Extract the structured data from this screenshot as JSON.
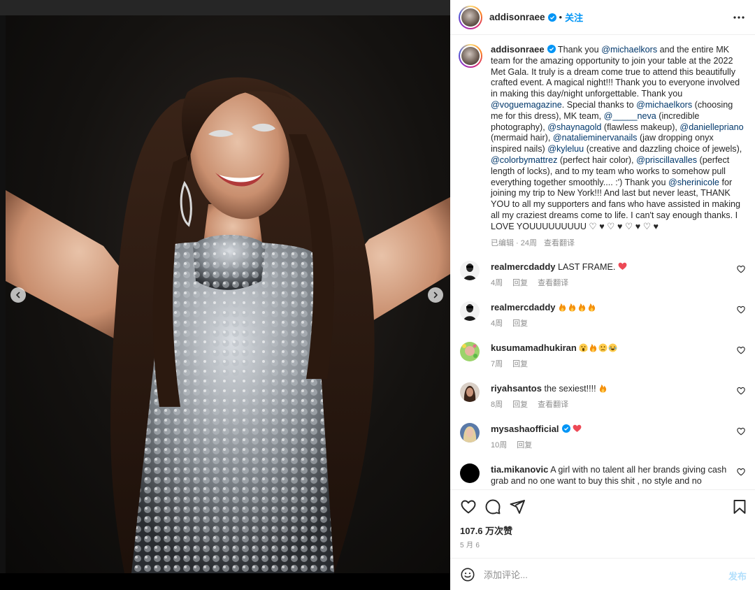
{
  "post": {
    "username": "addisonraee",
    "follow_label": "关注",
    "separator": "•"
  },
  "caption": {
    "username": "addisonraee",
    "segments": [
      {
        "t": "Thank you ",
        "m": false
      },
      {
        "t": "@michaelkors",
        "m": true
      },
      {
        "t": " and the entire MK team for the amazing opportunity to join your table at the 2022 Met Gala. It truly is a dream come true to attend this beautifully crafted event. A magical night!!! Thank you to everyone involved in making this day/night unforgettable. Thank you ",
        "m": false
      },
      {
        "t": "@voguemagazine",
        "m": true
      },
      {
        "t": ". Special thanks to ",
        "m": false
      },
      {
        "t": "@michaelkors",
        "m": true
      },
      {
        "t": " (choosing me for this dress), MK team, ",
        "m": false
      },
      {
        "t": "@_____neva",
        "m": true
      },
      {
        "t": " (incredible photography), ",
        "m": false
      },
      {
        "t": "@shaynagold",
        "m": true
      },
      {
        "t": " (flawless makeup), ",
        "m": false
      },
      {
        "t": "@daniellepriano",
        "m": true
      },
      {
        "t": " (mermaid hair), ",
        "m": false
      },
      {
        "t": "@natalieminervanails",
        "m": true
      },
      {
        "t": " (jaw dropping onyx inspired nails) ",
        "m": false
      },
      {
        "t": "@kyleluu",
        "m": true
      },
      {
        "t": " (creative and dazzling choice of jewels), ",
        "m": false
      },
      {
        "t": "@colorbymattrez",
        "m": true
      },
      {
        "t": " (perfect hair color), ",
        "m": false
      },
      {
        "t": "@priscillavalles",
        "m": true
      },
      {
        "t": " (perfect length of locks), and to my team who works to somehow pull everything together smoothly.... :') Thank you ",
        "m": false
      },
      {
        "t": "@sherinicole",
        "m": true
      },
      {
        "t": " for joining my trip to New York!!! And last but never least, THANK YOU to all my supporters and fans who have assisted in making all my craziest dreams come to life. I can't say enough thanks. I LOVE YOUUUUUUUUU ♡ ♥ ♡ ♥ ♡ ♥ ♡ ♥",
        "m": false
      }
    ],
    "edited": "已编辑 · 24周",
    "translate": "查看翻译"
  },
  "comments": [
    {
      "user": "realmercdaddy",
      "text": "LAST FRAME.",
      "emoji": [
        "heart"
      ],
      "verified": false,
      "age": "4周",
      "reply": "回复",
      "translate": "查看翻译",
      "avatar": "bw-man"
    },
    {
      "user": "realmercdaddy",
      "text": "",
      "emoji": [
        "fire",
        "fire",
        "fire",
        "fire"
      ],
      "verified": false,
      "age": "4周",
      "reply": "回复",
      "translate": "",
      "avatar": "bw-man"
    },
    {
      "user": "kusumamadhukiran",
      "text": "",
      "emoji": [
        "scream",
        "fire",
        "sad",
        "laugh"
      ],
      "verified": false,
      "age": "7周",
      "reply": "回复",
      "translate": "",
      "avatar": "green"
    },
    {
      "user": "riyahsantos",
      "text": "the sexiest!!!!",
      "emoji": [
        "fire"
      ],
      "verified": false,
      "age": "8周",
      "reply": "回复",
      "translate": "查看翻译",
      "avatar": "woman"
    },
    {
      "user": "mysashaofficial",
      "text": "",
      "emoji": [
        "heart"
      ],
      "verified": true,
      "age": "10周",
      "reply": "回复",
      "translate": "",
      "avatar": "blonde"
    },
    {
      "user": "tia.mikanovic",
      "text": "A girl with no talent all her brands giving cash grab and no one want to buy this shit , no style and no",
      "emoji": [],
      "verified": false,
      "age": "",
      "reply": "",
      "translate": "",
      "avatar": "black"
    }
  ],
  "stats": {
    "likes": "107.6 万次赞",
    "date": "5 月 6"
  },
  "add_comment": {
    "placeholder": "添加评论...",
    "post_label": "发布"
  },
  "colors": {
    "link": "#00376b",
    "follow": "#0095f6",
    "post_disabled": "#b2dffc",
    "heart": "#ed4956"
  },
  "carousel": {
    "count": 3,
    "active": 0
  }
}
